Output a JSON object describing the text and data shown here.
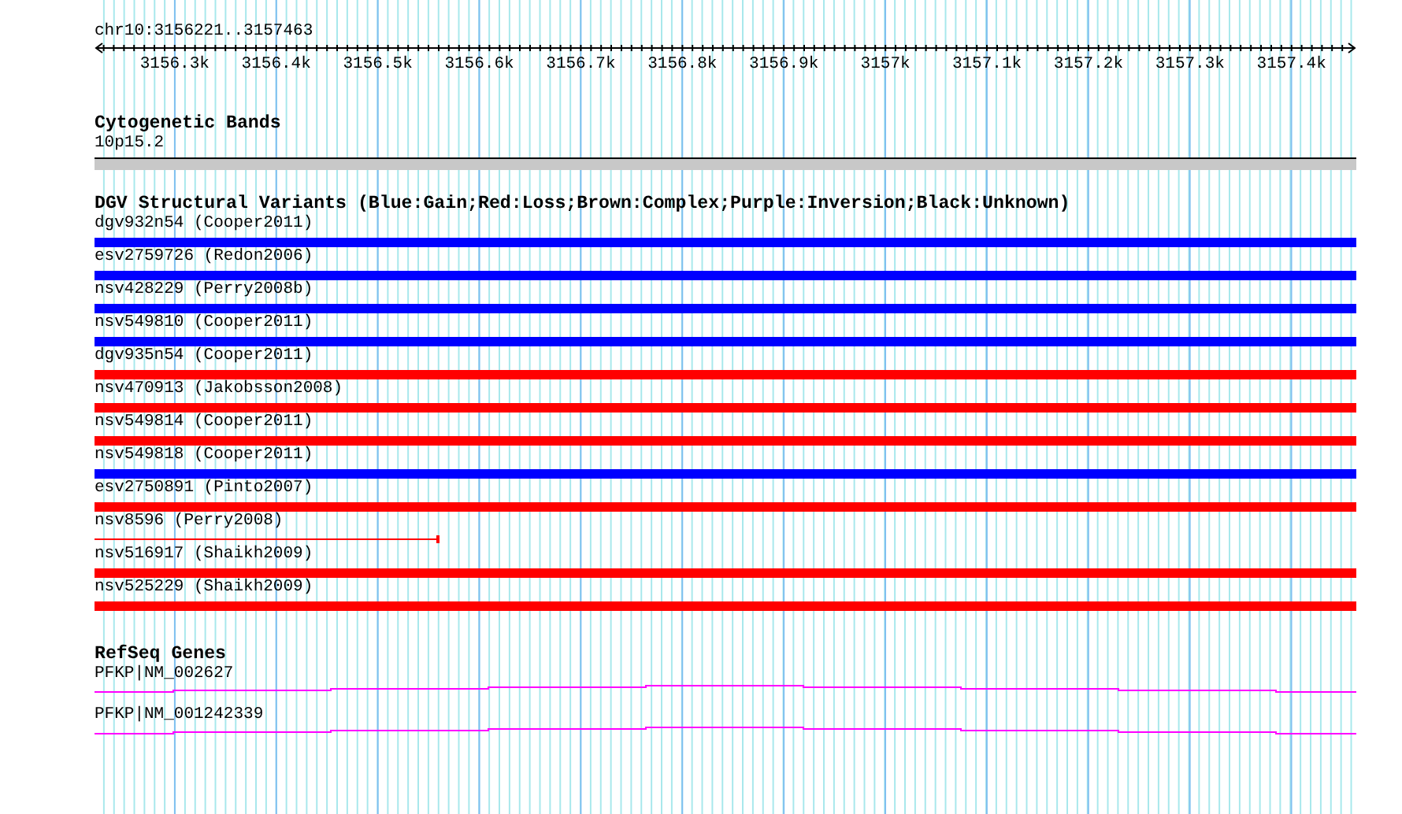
{
  "ruler": {
    "label": "chr10:3156221..3157463",
    "ticks": [
      "3156.3k",
      "3156.4k",
      "3156.5k",
      "3156.6k",
      "3156.7k",
      "3156.8k",
      "3156.9k",
      "3157k",
      "3157.1k",
      "3157.2k",
      "3157.3k",
      "3157.4k"
    ]
  },
  "cytogenetic_bands": {
    "title": "Cytogenetic Bands",
    "band": "10p15.2"
  },
  "dgv": {
    "title": "DGV Structural Variants (Blue:Gain;Red:Loss;Brown:Complex;Purple:Inversion;Black:Unknown)",
    "variants": [
      {
        "name": "dgv932n54 (Cooper2011)",
        "kind": "bar",
        "color": "#0000ff"
      },
      {
        "name": "esv2759726 (Redon2006)",
        "kind": "bar",
        "color": "#0000ff"
      },
      {
        "name": "nsv428229 (Perry2008b)",
        "kind": "bar",
        "color": "#0000ff"
      },
      {
        "name": "nsv549810 (Cooper2011)",
        "kind": "bar",
        "color": "#0000ff"
      },
      {
        "name": "dgv935n54 (Cooper2011)",
        "kind": "bar",
        "color": "#ff0000"
      },
      {
        "name": "nsv470913 (Jakobsson2008)",
        "kind": "bar",
        "color": "#ff0000"
      },
      {
        "name": "nsv549814 (Cooper2011)",
        "kind": "bar",
        "color": "#ff0000"
      },
      {
        "name": "nsv549818 (Cooper2011)",
        "kind": "bar",
        "color": "#0000ff"
      },
      {
        "name": "esv2750891 (Pinto2007)",
        "kind": "bar",
        "color": "#ff0000"
      },
      {
        "name": "nsv8596 (Perry2008)",
        "kind": "line",
        "color": "#ff0000"
      },
      {
        "name": "nsv516917 (Shaikh2009)",
        "kind": "bar",
        "color": "#ff0000"
      },
      {
        "name": "nsv525229 (Shaikh2009)",
        "kind": "bar",
        "color": "#ff0000"
      }
    ]
  },
  "refseq_genes": {
    "title": "RefSeq Genes",
    "genes": [
      {
        "name": "PFKP|NM_002627"
      },
      {
        "name": "PFKP|NM_001242339"
      }
    ]
  }
}
